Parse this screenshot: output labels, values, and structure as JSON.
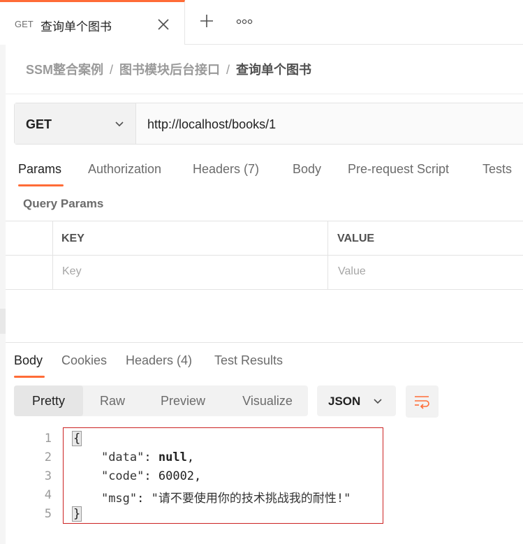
{
  "tab": {
    "method": "GET",
    "title": "查询单个图书"
  },
  "breadcrumb": {
    "items": [
      "SSM整合案例",
      "图书模块后台接口"
    ],
    "separator": "/",
    "current": "查询单个图书"
  },
  "request": {
    "method": "GET",
    "url": "http://localhost/books/1",
    "tabs": [
      "Params",
      "Authorization",
      "Headers (7)",
      "Body",
      "Pre-request Script",
      "Tests"
    ],
    "active_tab": "Params"
  },
  "query_params": {
    "title": "Query Params",
    "columns": [
      "KEY",
      "VALUE"
    ],
    "placeholders": [
      "Key",
      "Value"
    ]
  },
  "response": {
    "tabs": [
      "Body",
      "Cookies",
      "Headers (4)",
      "Test Results"
    ],
    "active_tab": "Body",
    "view_modes": [
      "Pretty",
      "Raw",
      "Preview",
      "Visualize"
    ],
    "active_view": "Pretty",
    "format": "JSON",
    "code_lines": [
      {
        "n": "1",
        "text": "{"
      },
      {
        "n": "2",
        "key": "\"data\"",
        "value": "null",
        "trail": ","
      },
      {
        "n": "3",
        "key": "\"code\"",
        "value": "60002",
        "trail": ","
      },
      {
        "n": "4",
        "key": "\"msg\"",
        "value": "\"请不要使用你的技术挑战我的耐性!\"",
        "trail": ""
      },
      {
        "n": "5",
        "text": "}"
      }
    ]
  },
  "colors": {
    "accent": "#ff6c37",
    "highlight_border": "#cc2222"
  },
  "icons": [
    "close-icon",
    "plus-icon",
    "more-icon",
    "chevron-down-icon",
    "wrap-lines-icon"
  ]
}
